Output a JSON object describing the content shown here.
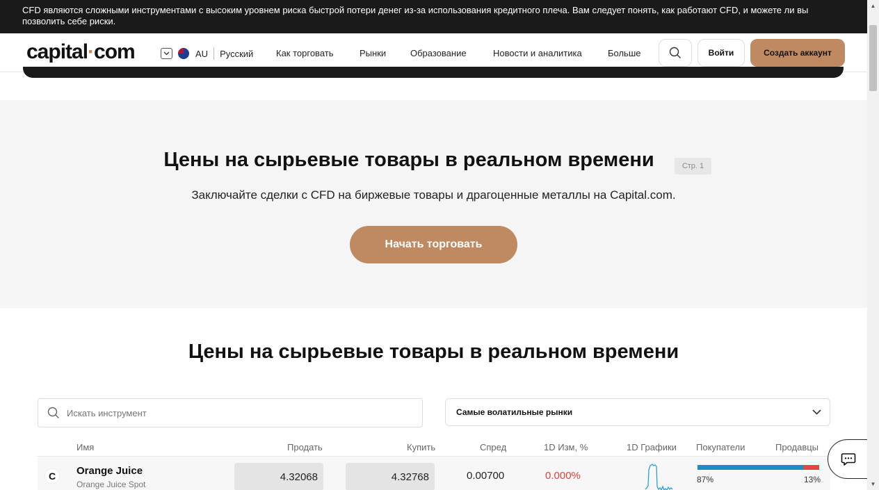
{
  "risk_warning": "CFD являются сложными инструментами с высоким уровнем риска быстрой потери денег из-за использования кредитного плеча. Вам следует понять, как работают CFD, и можете ли вы позволить себе риски.",
  "header": {
    "logo_left": "capital",
    "logo_dot": "·",
    "logo_right": "com",
    "region": "AU",
    "language": "Русский",
    "nav": [
      "Как торговать",
      "Рынки",
      "Образование",
      "Новости и аналитика",
      "Больше"
    ],
    "login_label": "Войти",
    "signup_label": "Создать аккаунт"
  },
  "hero": {
    "title": "Цены на сырьевые товары в реальном времени",
    "page_badge": "Стр. 1",
    "subtitle": "Заключайте сделки с CFD на биржевые товары и драгоценные металлы на Capital.com.",
    "cta_label": "Начать торговать"
  },
  "section": {
    "title": "Цены на сырьевые товары в реальном времени",
    "search_placeholder": "Искать инструмент",
    "filter_selected": "Самые волатильные рынки"
  },
  "table": {
    "columns": [
      "Имя",
      "Продать",
      "Купить",
      "Спред",
      "1D Изм, %",
      "1D Графики",
      "Покупатели",
      "Продавцы"
    ],
    "rows": [
      {
        "logo": "C",
        "name": "Orange Juice",
        "subtitle": "Orange Juice Spot",
        "sell": "4.32068",
        "buy": "4.32768",
        "spread": "0.00700",
        "change": "0.000%",
        "buyers_pct": "87%",
        "sellers_pct": "13%",
        "buyers_fraction": 0.87
      }
    ]
  },
  "colors": {
    "accent": "#bf8a61",
    "negative": "#e2403a",
    "buyers": "#1a8fc4",
    "sellers": "#e04848",
    "sparkline": "#2a9fd6"
  },
  "icons": [
    "chevron-down-icon",
    "flag-au-icon",
    "search-icon",
    "chat-icon",
    "sparkline-chart"
  ]
}
